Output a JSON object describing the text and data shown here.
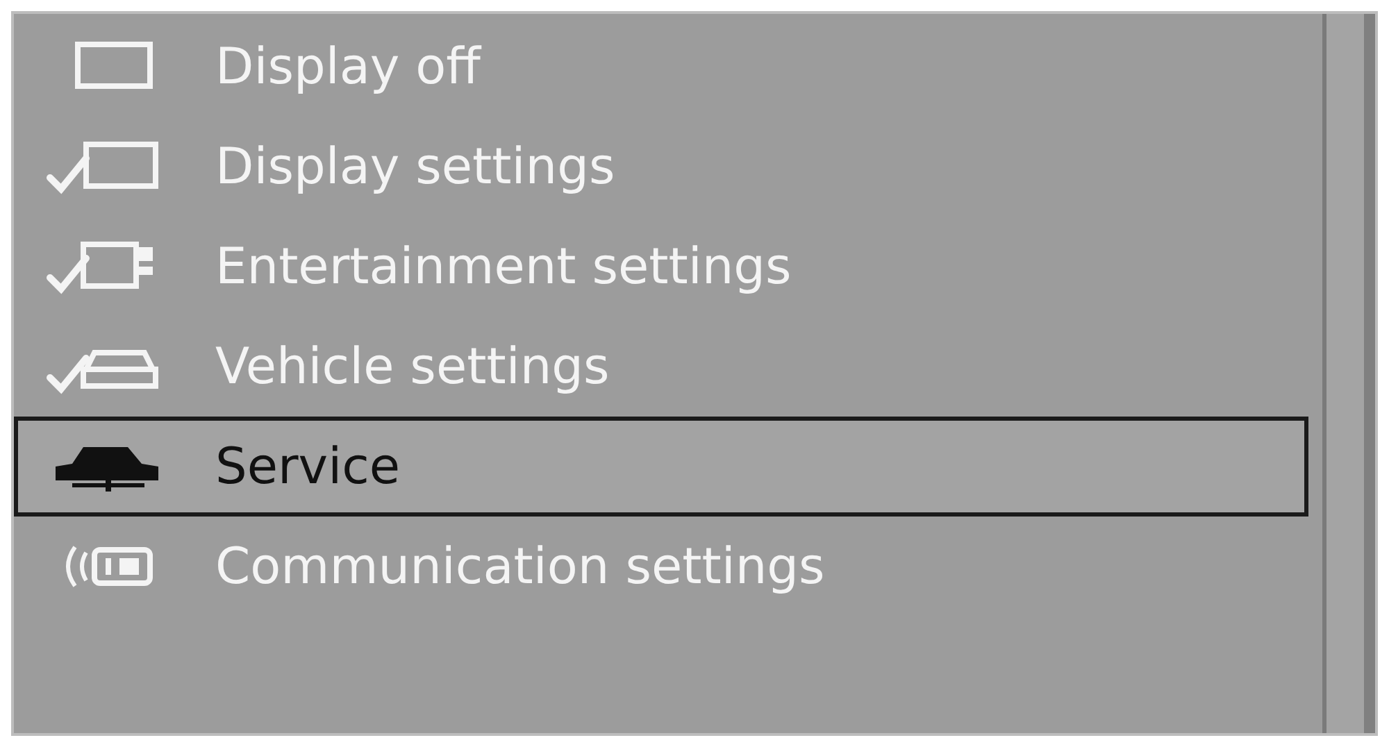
{
  "menu": {
    "items": [
      {
        "label": "Display off",
        "kind": "screen",
        "selected": false
      },
      {
        "label": "Display settings",
        "kind": "screen-check",
        "selected": false
      },
      {
        "label": "Entertainment settings",
        "kind": "media-check",
        "selected": false
      },
      {
        "label": "Vehicle settings",
        "kind": "vehicle-check",
        "selected": false
      },
      {
        "label": "Service",
        "kind": "car",
        "selected": true
      },
      {
        "label": "Communication settings",
        "kind": "signal",
        "selected": false
      }
    ]
  }
}
